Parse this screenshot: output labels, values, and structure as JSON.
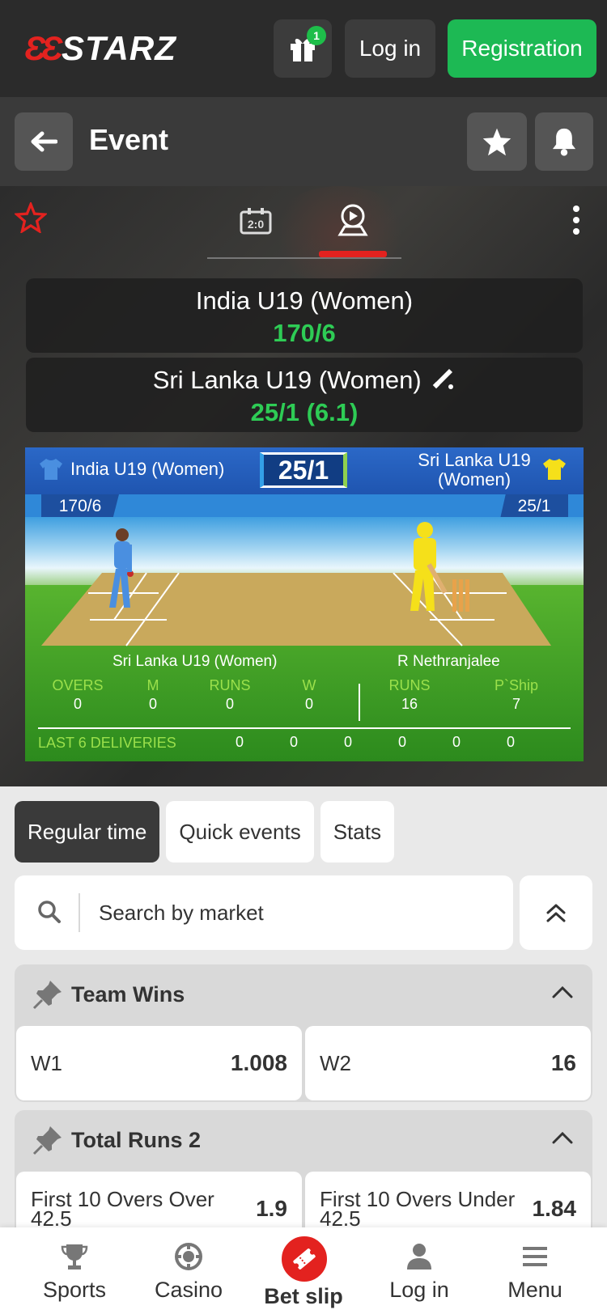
{
  "header": {
    "logo_mark": "ƐƐ",
    "logo_text": "STARZ",
    "gift_badge": "1",
    "login_label": "Log in",
    "registration_label": "Registration"
  },
  "event_bar": {
    "title": "Event"
  },
  "scoreboard": {
    "team1": {
      "name": "India U19 (Women)",
      "score": "170/6"
    },
    "team2": {
      "name": "Sri Lanka U19 (Women)",
      "score": "25/1 (6.1)"
    }
  },
  "pitch": {
    "team1": "India U19 (Women)",
    "team2": "Sri Lanka U19 (Women)",
    "score": "25/1",
    "team1_total": "170/6",
    "team2_total": "25/1",
    "batting_team": "Sri Lanka U19 (Women)",
    "batter": "R Nethranjalee",
    "stats": [
      {
        "label": "OVERS",
        "value": "0"
      },
      {
        "label": "M",
        "value": "0"
      },
      {
        "label": "RUNS",
        "value": "0"
      },
      {
        "label": "W",
        "value": "0"
      },
      {
        "label": "RUNS",
        "value": "16"
      },
      {
        "label": "P`Ship",
        "value": "7"
      }
    ],
    "last6_label": "LAST 6 DELIVERIES",
    "last6": [
      "0",
      "0",
      "0",
      "0",
      "0",
      "0"
    ],
    "colors": {
      "team1_shirt": "#4a8fe0",
      "team2_shirt": "#f5e01a"
    }
  },
  "tabs": [
    {
      "label": "Regular time",
      "active": true
    },
    {
      "label": "Quick events",
      "active": false
    },
    {
      "label": "Stats",
      "active": false
    }
  ],
  "search": {
    "placeholder": "Search by market"
  },
  "markets": [
    {
      "title": "Team Wins",
      "odds": [
        {
          "name": "W1",
          "value": "1.008"
        },
        {
          "name": "W2",
          "value": "16"
        }
      ]
    },
    {
      "title": "Total Runs 2",
      "odds": [
        {
          "name": "First 10 Overs Over 42.5",
          "value": "1.9"
        },
        {
          "name": "First 10 Overs Under 42.5",
          "value": "1.84"
        }
      ]
    }
  ],
  "bottom_nav": {
    "sports": "Sports",
    "casino": "Casino",
    "betslip": "Bet slip",
    "login": "Log in",
    "menu": "Menu"
  },
  "colors": {
    "accent_red": "#e3221f",
    "accent_green": "#1db954"
  }
}
